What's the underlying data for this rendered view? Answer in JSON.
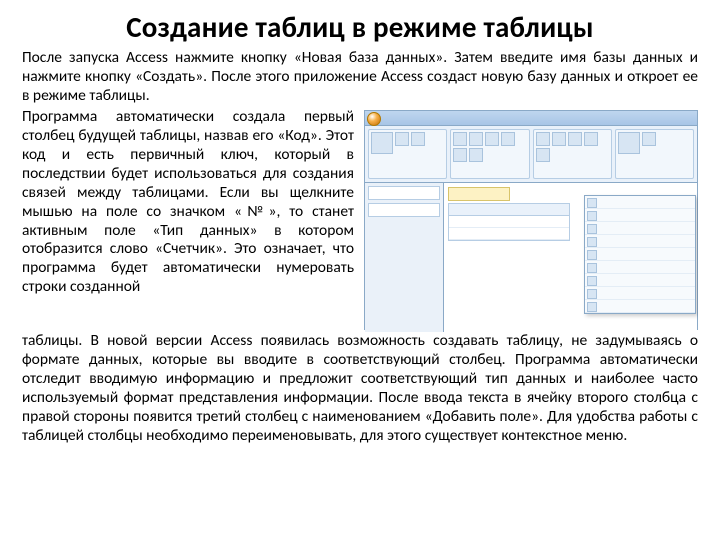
{
  "title": "Создание таблиц в режиме таблицы",
  "intro": "После запуска Access нажмите кнопку «Новая база данных». Затем введите имя базы данных и нажмите кнопку «Создать». После этого приложение Access создаст новую базу данных и откроет ее в режиме таблицы.",
  "wrapped": "Программа автоматически создала первый столбец будущей таблицы, назвав его «Код». Этот код и есть первичный ключ, который в последствии будет использоваться для создания связей между таблицами. Если вы щелкните мышью на поле со значком «№», то станет активным поле «Тип данных» в котором отобразится слово «Счетчик». Это означает, что программа будет автоматически нумеровать строки созданной",
  "rest": "таблицы. В новой версии Access появилась возможность создавать таблицу, не задумываясь о формате данных, которые вы вводите в соответствующий столбец. Программа автоматически отследит вводимую информацию и предложит соответствующий тип данных и наиболее часто используемый формат представления информации. После ввода текста в ячейку второго столбца с правой стороны появится третий столбец с наименованием «Добавить поле». Для удобства работы с таблицей столбцы необходимо переименовывать, для этого существует контекстное меню."
}
